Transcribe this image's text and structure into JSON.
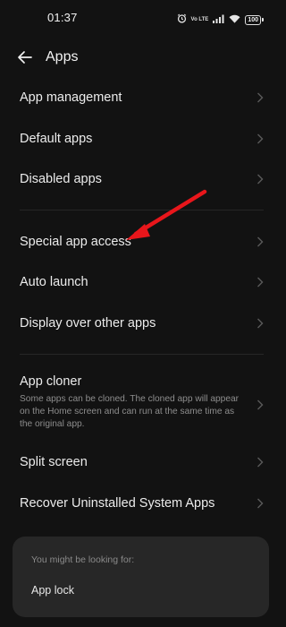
{
  "status_bar": {
    "time": "01:37",
    "network_label": "Vo LTE",
    "battery_level": "100"
  },
  "header": {
    "title": "Apps",
    "back_icon": "arrow-left-icon"
  },
  "menu": {
    "group1": [
      {
        "label": "App management"
      },
      {
        "label": "Default apps"
      },
      {
        "label": "Disabled apps"
      }
    ],
    "group2": [
      {
        "label": "Special app access"
      },
      {
        "label": "Auto launch"
      },
      {
        "label": "Display over other apps"
      }
    ],
    "app_cloner": {
      "title": "App cloner",
      "description": "Some apps can be cloned. The cloned app will appear on the Home screen and can run at the same time as the original app."
    },
    "group3": [
      {
        "label": "Split screen"
      },
      {
        "label": "Recover Uninstalled System Apps"
      }
    ]
  },
  "suggestion": {
    "heading": "You might be looking for:",
    "item": "App lock"
  },
  "colors": {
    "background": "#121212",
    "card": "#272727",
    "annotation_arrow": "#e8161b"
  }
}
